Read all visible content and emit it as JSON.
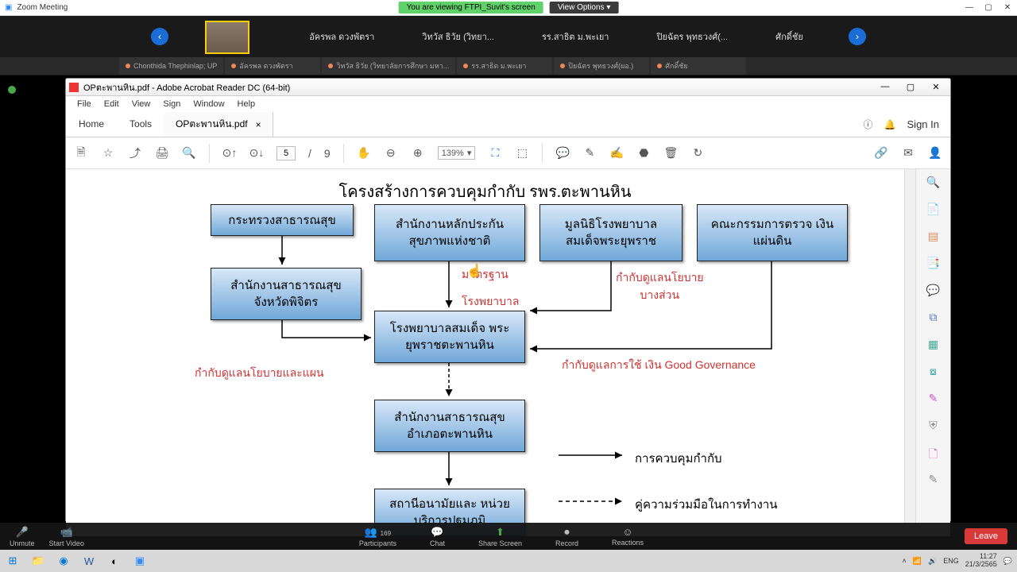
{
  "zoom": {
    "title": "Zoom Meeting",
    "share_banner": "You are viewing FTPI_Suvit's screen",
    "view_options": "View Options ▾",
    "view_btn": "View",
    "participants_row": [
      "อัครพล ดวงพัตรา",
      "วิทวัส ธิวัย (วิทยา...",
      "รร.สาธิต ม.พะเยา",
      "ปิยฉัตร พุทธวงศ์(...",
      "ศักดิ์ชัย"
    ],
    "src_tabs": [
      "Chonthida Thephinlap; UP",
      "อัครพล ดวงพัตรา",
      "วิทวัส ธิวัย (วิทยาลัยการศึกษา มหา...",
      "รร.สาธิต ม.พะเยา",
      "ปิยฉัตร พุทธวงศ์(ผอ.)",
      "ศักดิ์ชัย"
    ],
    "controls": {
      "unmute": "Unmute",
      "start_video": "Start Video",
      "participants": "Participants",
      "participants_count": "169",
      "chat": "Chat",
      "share": "Share Screen",
      "record": "Record",
      "reactions": "Reactions",
      "leave": "Leave"
    }
  },
  "acrobat": {
    "title": "OPตะพานหิน.pdf - Adobe Acrobat Reader DC (64-bit)",
    "menu": [
      "File",
      "Edit",
      "View",
      "Sign",
      "Window",
      "Help"
    ],
    "tabs": {
      "home": "Home",
      "tools": "Tools",
      "doc": "OPตะพานหิน.pdf",
      "close": "×"
    },
    "signin": "Sign In",
    "page_current": "5",
    "page_sep": "/",
    "page_total": "9",
    "zoom": "139%"
  },
  "chart_data": {
    "type": "diagram",
    "title": "โครงสร้างการควบคุมกำกับ  รพร.ตะพานหิน",
    "boxes": {
      "b1": "กระทรวงสาธารณสุข",
      "b2": "สำนักงานหลักประกัน\nสุขภาพแห่งชาติ",
      "b3": "มูลนิธิโรงพยาบาล\nสมเด็จพระยุพราช",
      "b4": "คณะกรรมการตรวจ\nเงินแผ่นดิน",
      "b5": "สำนักงานสาธารณสุข\nจังหวัดพิจิตร",
      "b6": "โรงพยาบาลสมเด็จ\nพระยุพราชตะพานหิน",
      "b7": "สำนักงานสาธารณสุข\nอำเภอตะพานหิน",
      "b8": "สถานีอนามัยและ\nหน่วยบริการปฐมภูมิ"
    },
    "annot": {
      "a1": "มาตรฐาน",
      "a2": "โรงพยาบาล",
      "a3": "กำกับดูแลนโยบาย\nบางส่วน",
      "a4": "กำกับดูแลนโยบายและแผน",
      "a5": "กำกับดูแลการใช้ เงิน  Good  Governance",
      "legend1": "การควบคุมกำกับ",
      "legend2": "คู่ความร่วมมือในการทำงาน"
    }
  },
  "taskbar": {
    "time": "11:27",
    "date": "21/3/2565"
  }
}
